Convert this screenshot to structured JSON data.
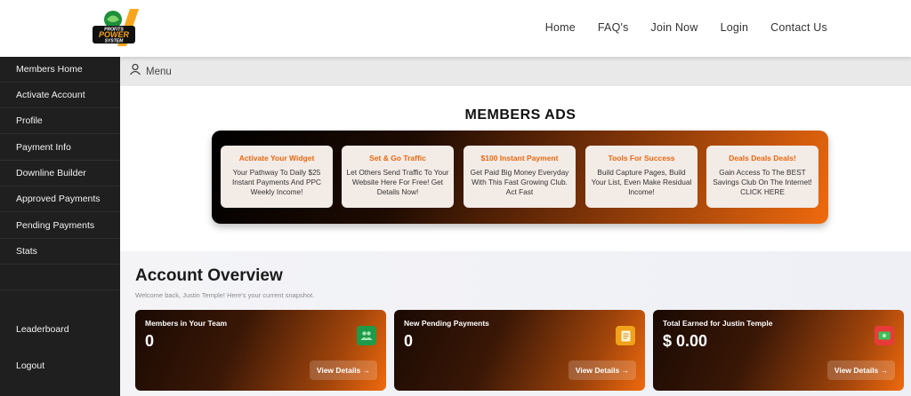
{
  "brand": {
    "line1": "PROFITS",
    "line2": "POWER",
    "line3": "SYSTEM"
  },
  "nav": {
    "home": "Home",
    "faq": "FAQ's",
    "join": "Join Now",
    "login": "Login",
    "contact": "Contact Us"
  },
  "sidebar": {
    "items": [
      "Members Home",
      "Activate Account",
      "Profile",
      "Payment Info",
      "Downline Builder",
      "Approved Payments",
      "Pending Payments",
      "Stats"
    ],
    "leaderboard": "Leaderboard",
    "logout": "Logout"
  },
  "menu": {
    "label": "Menu"
  },
  "ads": {
    "title": "MEMBERS ADS",
    "cards": [
      {
        "title": "Activate Your Widget",
        "desc": "Your Pathway To Daily $25 Instant Payments And PPC Weekly Income!"
      },
      {
        "title": "Set & Go Traffic",
        "desc": "Let Others Send Traffic To Your Website Here For Free! Get Details Now!"
      },
      {
        "title": "$100 Instant Payment",
        "desc": "Get Paid Big Money Everyday With This Fast Growing Club. Act Fast"
      },
      {
        "title": "Tools For Success",
        "desc": "Build Capture Pages, Build Your List, Even Make Residual Income!"
      },
      {
        "title": "Deals Deals Deals!",
        "desc": "Gain Access To The BEST Savings Club On The Internet! CLICK HERE"
      }
    ]
  },
  "overview": {
    "title": "Account Overview",
    "subtitle": "Welcome back, Justin Temple! Here's your current snapshot.",
    "stats": [
      {
        "label": "Members in Your Team",
        "value": "0",
        "button": "View Details →",
        "icon": "team-icon",
        "color": "#1e9b4a"
      },
      {
        "label": "New Pending Payments",
        "value": "0",
        "button": "View Details →",
        "icon": "document-icon",
        "color": "#f0a21a"
      },
      {
        "label": "Total Earned for Justin Temple",
        "value": "$ 0.00",
        "button": "View Details →",
        "icon": "money-icon",
        "color": "#e83a3a"
      }
    ]
  }
}
